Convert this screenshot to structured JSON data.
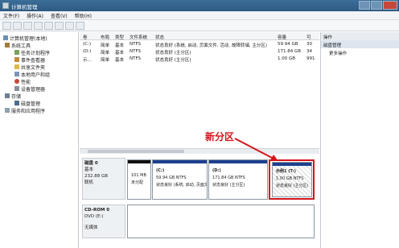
{
  "window": {
    "title": "计算机管理"
  },
  "menu": [
    "文件(F)",
    "操作(A)",
    "查看(V)",
    "帮助(H)"
  ],
  "tree": {
    "root": "计算机管理(本地)",
    "system_tools": "系统工具",
    "task_scheduler": "任务计划程序",
    "event_viewer": "事件查看器",
    "shared_folders": "共享文件夹",
    "local_users": "本地用户和组",
    "performance": "性能",
    "device_manager": "设备管理器",
    "storage": "存储",
    "disk_management": "磁盘管理",
    "services": "服务和应用程序"
  },
  "volumes": {
    "headers": [
      "卷",
      "布局",
      "类型",
      "文件系统",
      "状态",
      "容量",
      "可"
    ],
    "rows": [
      {
        "vol": "(C:)",
        "layout": "简单",
        "type": "基本",
        "fs": "NTFS",
        "status": "状态良好 (系统, 启动, 页面文件, 活动, 故障转储, 主分区)",
        "cap": "59.94 GB",
        "free": "30"
      },
      {
        "vol": "(D:)",
        "layout": "简单",
        "type": "基本",
        "fs": "NTFS",
        "status": "状态良好 (主分区)",
        "cap": "171.84 GB",
        "free": "34"
      },
      {
        "vol": "示...",
        "layout": "简单",
        "type": "基本",
        "fs": "NTFS",
        "status": "状态良好 (主分区)",
        "cap": "1.00 GB",
        "free": "991"
      }
    ]
  },
  "disk0": {
    "name": "磁盘 0",
    "type": "基本",
    "size": "232.88 GB",
    "status": "联机",
    "partitions": [
      {
        "size": "101 MB",
        "status": "未分配"
      },
      {
        "name": "(C:)",
        "size": "59.94 GB NTFS",
        "status": "状态良好 (系统, 启动, 页面文件"
      },
      {
        "name": "(D:)",
        "size": "171.84 GB NTFS",
        "status": "状态良好 (主分区)"
      },
      {
        "name": "示例1 (T:)",
        "size": "1.00 GB NTFS",
        "status": "状态良好 (主分区)"
      }
    ]
  },
  "cdrom0": {
    "name": "CD-ROM 0",
    "type": "DVD (E:)",
    "status": "无媒体"
  },
  "annotation": {
    "label": "新分区",
    "color": "#d3151b"
  },
  "actions": {
    "header": "操作",
    "section": "磁盘管理",
    "more": "更多操作"
  }
}
